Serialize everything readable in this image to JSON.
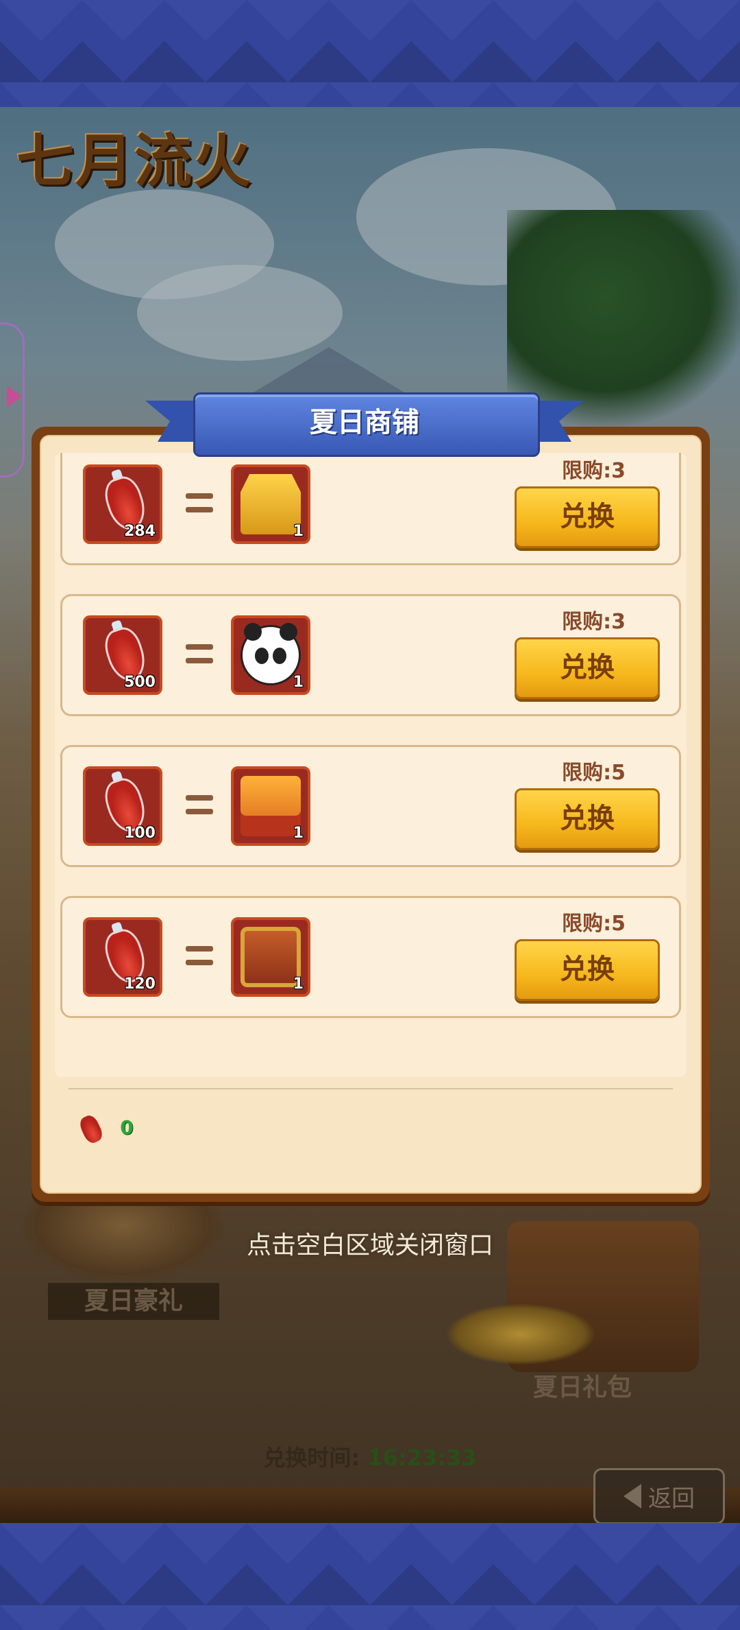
{
  "event_title": "七月流火",
  "shop": {
    "title": "夏日商铺",
    "items": [
      {
        "cost": "284",
        "reward_icon": "golden-chest-icon",
        "reward_count": "1",
        "limit": "限购:3",
        "button": "兑换"
      },
      {
        "cost": "500",
        "reward_icon": "panda-avatar-icon",
        "reward_count": "1",
        "limit": "限购:3",
        "button": "兑换"
      },
      {
        "cost": "100",
        "reward_icon": "orange-chest-icon",
        "reward_count": "1",
        "limit": "限购:5",
        "button": "兑换"
      },
      {
        "cost": "120",
        "reward_icon": "red-treasure-chest-icon",
        "reward_count": "1",
        "limit": "限购:5",
        "button": "兑换"
      }
    ],
    "currency_icon": "potion-bottle-icon",
    "balance": "0"
  },
  "close_hint": "点击空白区域关闭窗口",
  "background": {
    "gift_left": "夏日豪礼",
    "gift_right": "夏日礼包",
    "exchange_time_label": "兑换时间:",
    "exchange_time_value": "16:23:33",
    "back_label": "返回"
  },
  "colors": {
    "banner": "#3858b4",
    "button": "#f6b81c",
    "panel_border": "#7a3f12",
    "balance": "#2aa836"
  }
}
